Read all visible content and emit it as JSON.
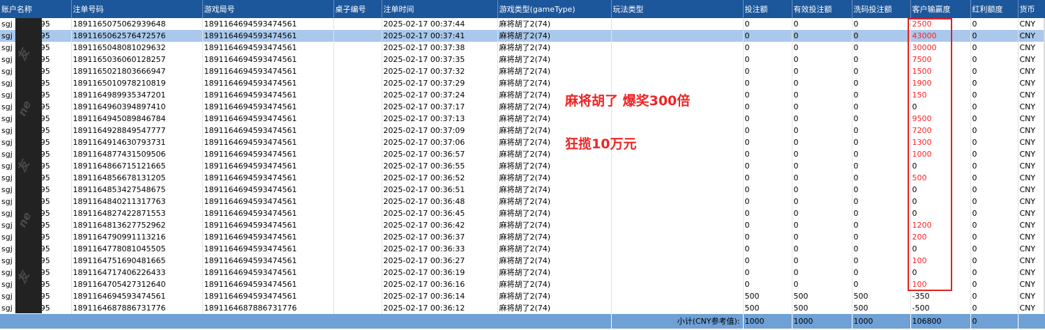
{
  "headers": [
    "账户名称",
    "注单号码",
    "游戏局号",
    "桌子编号",
    "注单时间",
    "游戏类型(gameType)",
    "玩法类型",
    "投注额",
    "有效投注额",
    "洗码投注额",
    "客户输赢度",
    "红利额度",
    "货币"
  ],
  "rows": [
    {
      "acct_prefix": "sgj",
      "acct_suffix": "95",
      "bet_no": "1891165075062939648",
      "round_no": "1891164694593474561",
      "time": "2025-02-17 00:37:44",
      "game": "麻将胡了2(74)",
      "bet": "0",
      "valid": "0",
      "wash": "0",
      "winloss": "2500",
      "bonus": "0",
      "currency": "CNY"
    },
    {
      "acct_prefix": "sgj",
      "acct_suffix": "95",
      "bet_no": "1891165062576472576",
      "round_no": "1891164694593474561",
      "time": "2025-02-17 00:37:41",
      "game": "麻将胡了2(74)",
      "bet": "0",
      "valid": "0",
      "wash": "0",
      "winloss": "43000",
      "bonus": "0",
      "currency": "CNY"
    },
    {
      "acct_prefix": "sgj",
      "acct_suffix": "95",
      "bet_no": "1891165048081029632",
      "round_no": "1891164694593474561",
      "time": "2025-02-17 00:37:38",
      "game": "麻将胡了2(74)",
      "bet": "0",
      "valid": "0",
      "wash": "0",
      "winloss": "30000",
      "bonus": "0",
      "currency": "CNY"
    },
    {
      "acct_prefix": "sgj",
      "acct_suffix": "95",
      "bet_no": "1891165036060128257",
      "round_no": "1891164694593474561",
      "time": "2025-02-17 00:37:35",
      "game": "麻将胡了2(74)",
      "bet": "0",
      "valid": "0",
      "wash": "0",
      "winloss": "7500",
      "bonus": "0",
      "currency": "CNY"
    },
    {
      "acct_prefix": "sgj",
      "acct_suffix": "95",
      "bet_no": "1891165021803666947",
      "round_no": "1891164694593474561",
      "time": "2025-02-17 00:37:32",
      "game": "麻将胡了2(74)",
      "bet": "0",
      "valid": "0",
      "wash": "0",
      "winloss": "1500",
      "bonus": "0",
      "currency": "CNY"
    },
    {
      "acct_prefix": "sgj",
      "acct_suffix": "95",
      "bet_no": "1891165010978210819",
      "round_no": "1891164694593474561",
      "time": "2025-02-17 00:37:29",
      "game": "麻将胡了2(74)",
      "bet": "0",
      "valid": "0",
      "wash": "0",
      "winloss": "1900",
      "bonus": "0",
      "currency": "CNY"
    },
    {
      "acct_prefix": "sgj",
      "acct_suffix": "95",
      "bet_no": "1891164989935347201",
      "round_no": "1891164694593474561",
      "time": "2025-02-17 00:37:24",
      "game": "麻将胡了2(74)",
      "bet": "0",
      "valid": "0",
      "wash": "0",
      "winloss": "150",
      "bonus": "0",
      "currency": "CNY"
    },
    {
      "acct_prefix": "sgj",
      "acct_suffix": "95",
      "bet_no": "1891164960394897410",
      "round_no": "1891164694593474561",
      "time": "2025-02-17 00:37:17",
      "game": "麻将胡了2(74)",
      "bet": "0",
      "valid": "0",
      "wash": "0",
      "winloss": "0",
      "bonus": "0",
      "currency": "CNY"
    },
    {
      "acct_prefix": "sgj",
      "acct_suffix": "95",
      "bet_no": "1891164945089846784",
      "round_no": "1891164694593474561",
      "time": "2025-02-17 00:37:13",
      "game": "麻将胡了2(74)",
      "bet": "0",
      "valid": "0",
      "wash": "0",
      "winloss": "9500",
      "bonus": "0",
      "currency": "CNY"
    },
    {
      "acct_prefix": "sgj",
      "acct_suffix": "95",
      "bet_no": "1891164928849547777",
      "round_no": "1891164694593474561",
      "time": "2025-02-17 00:37:09",
      "game": "麻将胡了2(74)",
      "bet": "0",
      "valid": "0",
      "wash": "0",
      "winloss": "7200",
      "bonus": "0",
      "currency": "CNY"
    },
    {
      "acct_prefix": "sgj",
      "acct_suffix": "95",
      "bet_no": "1891164914630793731",
      "round_no": "1891164694593474561",
      "time": "2025-02-17 00:37:06",
      "game": "麻将胡了2(74)",
      "bet": "0",
      "valid": "0",
      "wash": "0",
      "winloss": "1300",
      "bonus": "0",
      "currency": "CNY"
    },
    {
      "acct_prefix": "sgj",
      "acct_suffix": "95",
      "bet_no": "1891164877431509506",
      "round_no": "1891164694593474561",
      "time": "2025-02-17 00:36:57",
      "game": "麻将胡了2(74)",
      "bet": "0",
      "valid": "0",
      "wash": "0",
      "winloss": "1000",
      "bonus": "0",
      "currency": "CNY"
    },
    {
      "acct_prefix": "sgj",
      "acct_suffix": "95",
      "bet_no": "1891164866715121665",
      "round_no": "1891164694593474561",
      "time": "2025-02-17 00:36:55",
      "game": "麻将胡了2(74)",
      "bet": "0",
      "valid": "0",
      "wash": "0",
      "winloss": "0",
      "bonus": "0",
      "currency": "CNY"
    },
    {
      "acct_prefix": "sgj",
      "acct_suffix": "95",
      "bet_no": "1891164856678131205",
      "round_no": "1891164694593474561",
      "time": "2025-02-17 00:36:52",
      "game": "麻将胡了2(74)",
      "bet": "0",
      "valid": "0",
      "wash": "0",
      "winloss": "500",
      "bonus": "0",
      "currency": "CNY"
    },
    {
      "acct_prefix": "sgj",
      "acct_suffix": "95",
      "bet_no": "1891164853427548675",
      "round_no": "1891164694593474561",
      "time": "2025-02-17 00:36:51",
      "game": "麻将胡了2(74)",
      "bet": "0",
      "valid": "0",
      "wash": "0",
      "winloss": "0",
      "bonus": "0",
      "currency": "CNY"
    },
    {
      "acct_prefix": "sgj",
      "acct_suffix": "95",
      "bet_no": "1891164840211317763",
      "round_no": "1891164694593474561",
      "time": "2025-02-17 00:36:48",
      "game": "麻将胡了2(74)",
      "bet": "0",
      "valid": "0",
      "wash": "0",
      "winloss": "0",
      "bonus": "0",
      "currency": "CNY"
    },
    {
      "acct_prefix": "sgj",
      "acct_suffix": "95",
      "bet_no": "1891164827422871553",
      "round_no": "1891164694593474561",
      "time": "2025-02-17 00:36:45",
      "game": "麻将胡了2(74)",
      "bet": "0",
      "valid": "0",
      "wash": "0",
      "winloss": "0",
      "bonus": "0",
      "currency": "CNY"
    },
    {
      "acct_prefix": "sgj",
      "acct_suffix": "95",
      "bet_no": "1891164813627752962",
      "round_no": "1891164694593474561",
      "time": "2025-02-17 00:36:42",
      "game": "麻将胡了2(74)",
      "bet": "0",
      "valid": "0",
      "wash": "0",
      "winloss": "1200",
      "bonus": "0",
      "currency": "CNY"
    },
    {
      "acct_prefix": "sgj",
      "acct_suffix": "95",
      "bet_no": "1891164790991113216",
      "round_no": "1891164694593474561",
      "time": "2025-02-17 00:36:37",
      "game": "麻将胡了2(74)",
      "bet": "0",
      "valid": "0",
      "wash": "0",
      "winloss": "200",
      "bonus": "0",
      "currency": "CNY"
    },
    {
      "acct_prefix": "sgj",
      "acct_suffix": "95",
      "bet_no": "1891164778081045505",
      "round_no": "1891164694593474561",
      "time": "2025-02-17 00:36:33",
      "game": "麻将胡了2(74)",
      "bet": "0",
      "valid": "0",
      "wash": "0",
      "winloss": "0",
      "bonus": "0",
      "currency": "CNY"
    },
    {
      "acct_prefix": "sgj",
      "acct_suffix": "95",
      "bet_no": "1891164751690481665",
      "round_no": "1891164694593474561",
      "time": "2025-02-17 00:36:27",
      "game": "麻将胡了2(74)",
      "bet": "0",
      "valid": "0",
      "wash": "0",
      "winloss": "100",
      "bonus": "0",
      "currency": "CNY"
    },
    {
      "acct_prefix": "sgj",
      "acct_suffix": "95",
      "bet_no": "1891164717406226433",
      "round_no": "1891164694593474561",
      "time": "2025-02-17 00:36:19",
      "game": "麻将胡了2(74)",
      "bet": "0",
      "valid": "0",
      "wash": "0",
      "winloss": "0",
      "bonus": "0",
      "currency": "CNY"
    },
    {
      "acct_prefix": "sgj",
      "acct_suffix": "95",
      "bet_no": "1891164705427312640",
      "round_no": "1891164694593474561",
      "time": "2025-02-17 00:36:16",
      "game": "麻将胡了2(74)",
      "bet": "0",
      "valid": "0",
      "wash": "0",
      "winloss": "100",
      "bonus": "0",
      "currency": "CNY"
    },
    {
      "acct_prefix": "sgj",
      "acct_suffix": "95",
      "bet_no": "1891164694593474561",
      "round_no": "1891164694593474561",
      "time": "2025-02-17 00:36:14",
      "game": "麻将胡了2(74)",
      "bet": "500",
      "valid": "500",
      "wash": "500",
      "winloss": "-350",
      "bonus": "0",
      "currency": "CNY"
    },
    {
      "acct_prefix": "sgj",
      "acct_suffix": "95",
      "bet_no": "1891164687886731776",
      "round_no": "1891164687886731776",
      "time": "2025-02-17 00:36:12",
      "game": "麻将胡了2(74)",
      "bet": "500",
      "valid": "500",
      "wash": "500",
      "winloss": "-500",
      "bonus": "0",
      "currency": "CNY"
    }
  ],
  "selected_row": 1,
  "red_rows": [
    0,
    1,
    2,
    3,
    4,
    5,
    6,
    8,
    9,
    10,
    11,
    13,
    17,
    18,
    20,
    22
  ],
  "footer": {
    "label": "小计(CNY参考值):",
    "bet": "1000",
    "valid": "1000",
    "wash": "1000",
    "winloss": "106800",
    "bonus": "0"
  },
  "annotations": {
    "line1": "麻将胡了 爆奖300倍",
    "line2": "狂揽10万元"
  },
  "watermark": [
    "友",
    "ne",
    "友",
    "ne",
    "友"
  ],
  "colors": {
    "header_bg": "#1d579b",
    "selected_row": "#a9c8ec",
    "footer_bg": "#6fa0d6",
    "highlight_red": "#ff2020"
  }
}
